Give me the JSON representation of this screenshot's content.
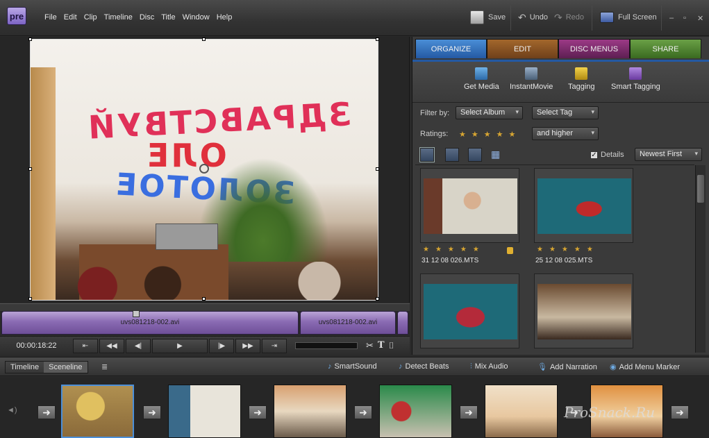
{
  "app": {
    "logo": "pre"
  },
  "menu": [
    "File",
    "Edit",
    "Clip",
    "Timeline",
    "Disc",
    "Title",
    "Window",
    "Help"
  ],
  "toolbar": {
    "save": "Save",
    "undo": "Undo",
    "redo": "Redo",
    "fullscreen": "Full Screen"
  },
  "monitor": {
    "timecode": "00:00:18:22",
    "clips": [
      "uvs081218-002.avi",
      "uvs081218-002.avi"
    ]
  },
  "tabs": [
    "ORGANIZE",
    "EDIT",
    "DISC MENUS",
    "SHARE"
  ],
  "organize_tools": [
    "Get Media",
    "InstantMovie",
    "Tagging",
    "Smart Tagging"
  ],
  "filter": {
    "filter_by_label": "Filter by:",
    "album": "Select Album",
    "tag": "Select Tag",
    "ratings_label": "Ratings:",
    "ratings_stars": "★★★★★",
    "higher": "and higher",
    "details_label": "Details",
    "sort": "Newest First"
  },
  "media": [
    {
      "name": "31 12 08 026.MTS",
      "stars": "★★★★★",
      "locked": true
    },
    {
      "name": "25 12 08 025.MTS",
      "stars": "★★★★★",
      "locked": false
    },
    {
      "name": "",
      "stars": "",
      "locked": false
    },
    {
      "name": "",
      "stars": "",
      "locked": false
    }
  ],
  "sceneline": {
    "mode_timeline": "Timeline",
    "mode_sceneline": "Sceneline",
    "smartsound": "SmartSound",
    "detect_beats": "Detect Beats",
    "mix_audio": "Mix Audio",
    "add_narration": "Add Narration",
    "add_menu_marker": "Add Menu Marker"
  },
  "watermark": "ProSnack.Ru",
  "colors": {
    "organize": "#2459a3",
    "edit": "#6f401a",
    "disc": "#5d1f52",
    "share": "#3a6a20",
    "clip": "#8a6bb3",
    "star": "#d8a632"
  }
}
